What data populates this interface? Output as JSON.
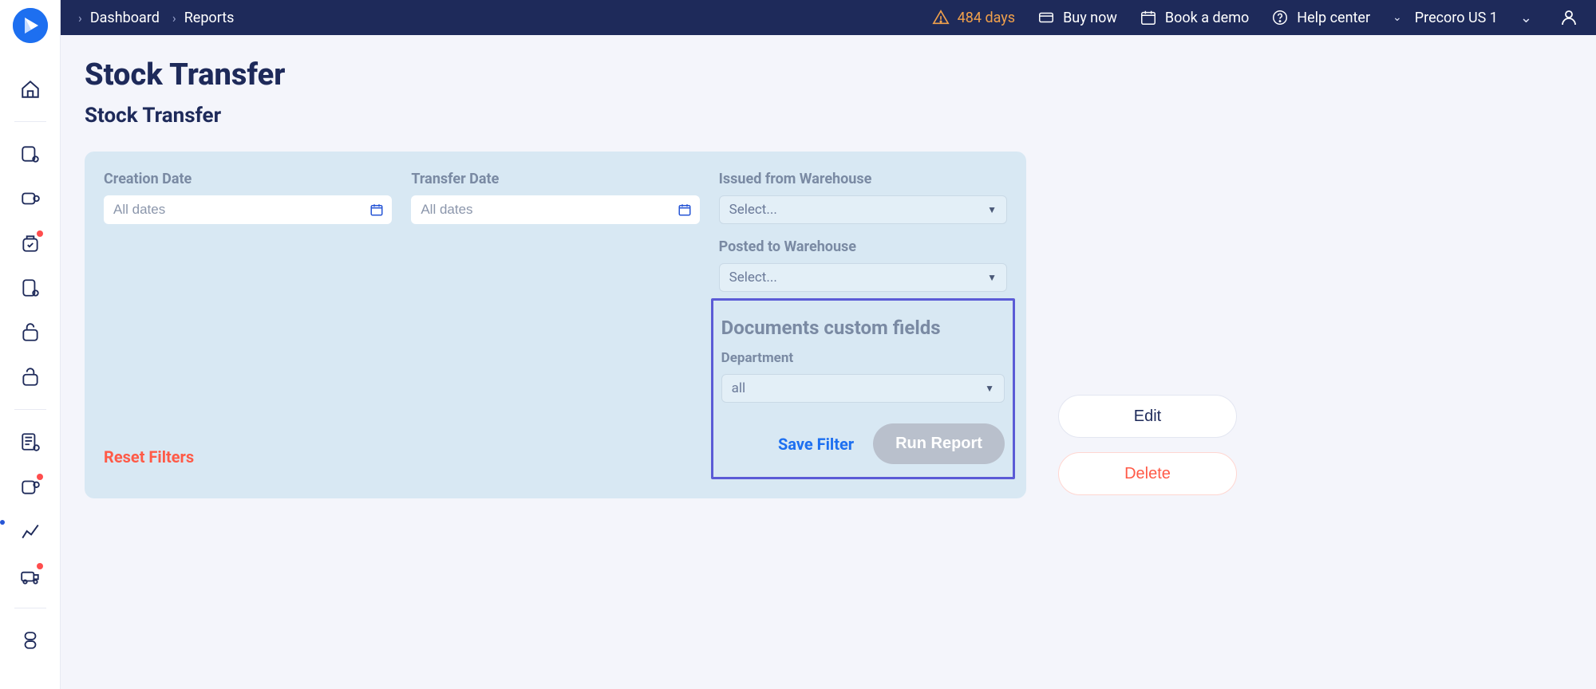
{
  "breadcrumb": {
    "item1": "Dashboard",
    "item2": "Reports"
  },
  "topbar": {
    "days": "484 days",
    "buy": "Buy now",
    "demo": "Book a demo",
    "help": "Help center",
    "org": "Precoro US 1"
  },
  "page": {
    "title": "Stock Transfer",
    "subtitle": "Stock Transfer"
  },
  "filters": {
    "creation": {
      "label": "Creation Date",
      "placeholder": "All dates"
    },
    "transfer": {
      "label": "Transfer Date",
      "placeholder": "All dates"
    },
    "issued": {
      "label": "Issued from Warehouse",
      "value": "Select..."
    },
    "posted": {
      "label": "Posted to Warehouse",
      "value": "Select..."
    },
    "custom_section": "Documents custom fields",
    "dept": {
      "label": "Department",
      "value": "all"
    }
  },
  "actions": {
    "reset": "Reset Filters",
    "save": "Save Filter",
    "run": "Run Report",
    "edit": "Edit",
    "delete": "Delete"
  }
}
